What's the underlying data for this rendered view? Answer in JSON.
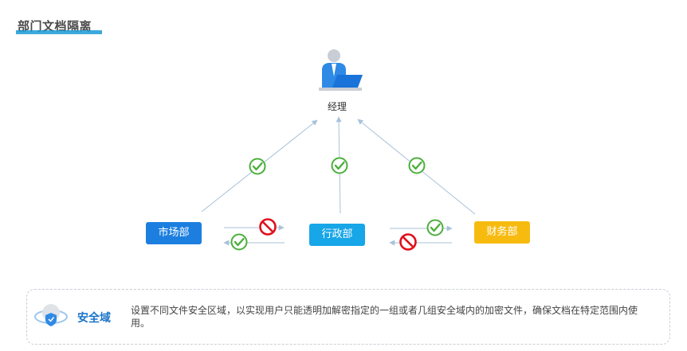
{
  "header": {
    "title": "部门文档隔离"
  },
  "diagram": {
    "manager": {
      "label": "经理",
      "icon": "manager-at-laptop-icon"
    },
    "departments": [
      {
        "label": "市场部",
        "color": "#1c7fe0"
      },
      {
        "label": "行政部",
        "color": "#17a6e8"
      },
      {
        "label": "财务部",
        "color": "#f7bb10"
      }
    ],
    "access": {
      "to_manager": "allowed",
      "market_to_admin": "denied",
      "admin_to_market": "allowed",
      "admin_to_finance": "allowed",
      "finance_to_admin": "denied"
    },
    "colors": {
      "allowed": "#4caf3c",
      "denied": "#e0101c",
      "line": "#a9c2da"
    }
  },
  "info": {
    "icon": "security-domain-shield-icon",
    "title": "安全域",
    "text": "设置不同文件安全区域，以实现用户只能透明加解密指定的一组或者几组安全域内的加密文件，确保文档在特定范围内使用。"
  }
}
